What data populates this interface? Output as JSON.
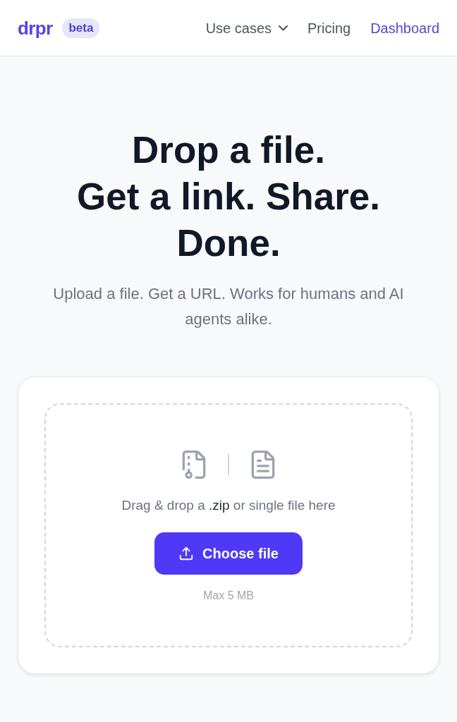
{
  "header": {
    "logo": "drpr",
    "badge": "beta",
    "nav": [
      {
        "label": "Use cases",
        "kind": "dropdown"
      },
      {
        "label": "Pricing",
        "kind": "link"
      },
      {
        "label": "Dashboard",
        "kind": "accent"
      }
    ]
  },
  "hero": {
    "headline": [
      "Drop a file.",
      "Get a link. Share.",
      "Done."
    ],
    "subtitle": "Upload a file. Get a URL. Works for humans and AI agents alike."
  },
  "upload": {
    "prompt": "Drag & drop a **.zip** or single file here",
    "button": "Choose file",
    "limit": "Max 5 MB"
  }
}
